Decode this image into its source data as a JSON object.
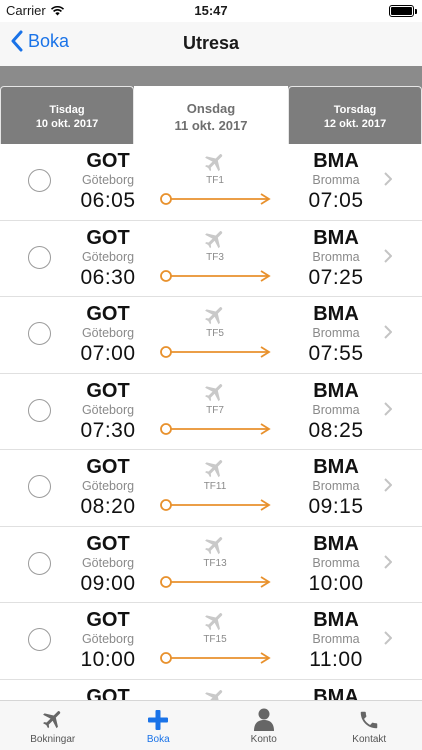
{
  "status": {
    "carrier": "Carrier",
    "time": "15:47"
  },
  "nav": {
    "back_label": "Boka",
    "title": "Utresa"
  },
  "dates": {
    "prev": {
      "day": "Tisdag",
      "date": "10 okt. 2017"
    },
    "current": {
      "day": "Onsdag",
      "date": "11 okt. 2017"
    },
    "next": {
      "day": "Torsdag",
      "date": "12 okt. 2017"
    }
  },
  "flights": [
    {
      "from_code": "GOT",
      "from_city": "Göteborg",
      "dep_time": "06:05",
      "flight_no": "TF1",
      "to_code": "BMA",
      "to_city": "Bromma",
      "arr_time": "07:05"
    },
    {
      "from_code": "GOT",
      "from_city": "Göteborg",
      "dep_time": "06:30",
      "flight_no": "TF3",
      "to_code": "BMA",
      "to_city": "Bromma",
      "arr_time": "07:25"
    },
    {
      "from_code": "GOT",
      "from_city": "Göteborg",
      "dep_time": "07:00",
      "flight_no": "TF5",
      "to_code": "BMA",
      "to_city": "Bromma",
      "arr_time": "07:55"
    },
    {
      "from_code": "GOT",
      "from_city": "Göteborg",
      "dep_time": "07:30",
      "flight_no": "TF7",
      "to_code": "BMA",
      "to_city": "Bromma",
      "arr_time": "08:25"
    },
    {
      "from_code": "GOT",
      "from_city": "Göteborg",
      "dep_time": "08:20",
      "flight_no": "TF11",
      "to_code": "BMA",
      "to_city": "Bromma",
      "arr_time": "09:15"
    },
    {
      "from_code": "GOT",
      "from_city": "Göteborg",
      "dep_time": "09:00",
      "flight_no": "TF13",
      "to_code": "BMA",
      "to_city": "Bromma",
      "arr_time": "10:00"
    },
    {
      "from_code": "GOT",
      "from_city": "Göteborg",
      "dep_time": "10:00",
      "flight_no": "TF15",
      "to_code": "BMA",
      "to_city": "Bromma",
      "arr_time": "11:00"
    },
    {
      "from_code": "GOT",
      "from_city": "",
      "dep_time": "",
      "flight_no": "",
      "to_code": "BMA",
      "to_city": "",
      "arr_time": ""
    }
  ],
  "tabs": [
    {
      "label": "Bokningar",
      "icon": "plane-icon"
    },
    {
      "label": "Boka",
      "icon": "plus-icon"
    },
    {
      "label": "Konto",
      "icon": "person-icon"
    },
    {
      "label": "Kontakt",
      "icon": "phone-icon"
    }
  ],
  "colors": {
    "accent": "#1a73e8",
    "route": "#e8912d",
    "header_gray": "#8b8b8b"
  }
}
